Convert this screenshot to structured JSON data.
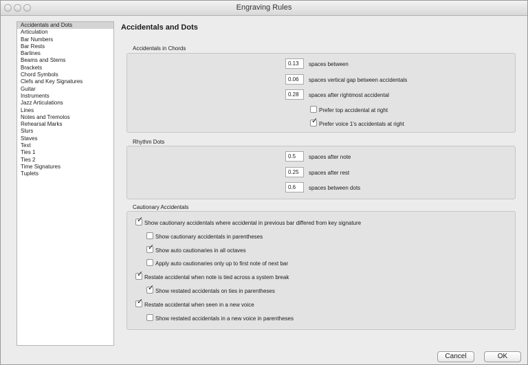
{
  "window": {
    "title": "Engraving Rules"
  },
  "sidebar": {
    "items": [
      "Accidentals and Dots",
      "Articulation",
      "Bar Numbers",
      "Bar Rests",
      "Barlines",
      "Beams and Stems",
      "Brackets",
      "Chord Symbols",
      "Clefs and Key Signatures",
      "Guitar",
      "Instruments",
      "Jazz Articulations",
      "Lines",
      "Notes and Tremolos",
      "Rehearsal Marks",
      "Slurs",
      "Staves",
      "Text",
      "Ties 1",
      "Ties 2",
      "Time Signatures",
      "Tuplets"
    ],
    "selected": "Accidentals and Dots"
  },
  "main": {
    "title": "Accidentals and Dots",
    "chords": {
      "label": "Accidentals in Chords",
      "fields": [
        {
          "value": "0.13",
          "label": "spaces between"
        },
        {
          "value": "0.06",
          "label": "spaces vertical gap between accidentals"
        },
        {
          "value": "0.28",
          "label": "spaces after rightmost accidental"
        }
      ],
      "checkboxes": [
        {
          "label": "Prefer top accidental at right",
          "checked": false
        },
        {
          "label": "Prefer voice 1's accidentals at right",
          "checked": true
        }
      ]
    },
    "rhythm": {
      "label": "Rhythm Dots",
      "fields": [
        {
          "value": "0.5",
          "label": "spaces after note"
        },
        {
          "value": "0.25",
          "label": "spaces after rest"
        },
        {
          "value": "0.6",
          "label": "spaces between dots"
        }
      ]
    },
    "cautionary": {
      "label": "Cautionary Accidentals",
      "checkboxes": [
        {
          "label": "Show cautionary accidentals where accidental in previous bar differed from key signature",
          "checked": true
        },
        {
          "label": "Show cautionary accidentals in parentheses",
          "checked": false
        },
        {
          "label": "Show auto cautionaries in all octaves",
          "checked": true
        },
        {
          "label": "Apply auto cautionaries only up to first note of next bar",
          "checked": false
        },
        {
          "label": "Restate accidental when note is tied across a system break",
          "checked": true
        },
        {
          "label": "Show restated accidentals on ties in parentheses",
          "checked": true
        },
        {
          "label": "Restate accidental when seen in a new voice",
          "checked": true
        },
        {
          "label": "Show restated accidentals in a new voice in parentheses",
          "checked": false
        }
      ]
    }
  },
  "footer": {
    "cancel_label": "Cancel",
    "ok_label": "OK"
  },
  "icons": {
    "check": "✓"
  }
}
